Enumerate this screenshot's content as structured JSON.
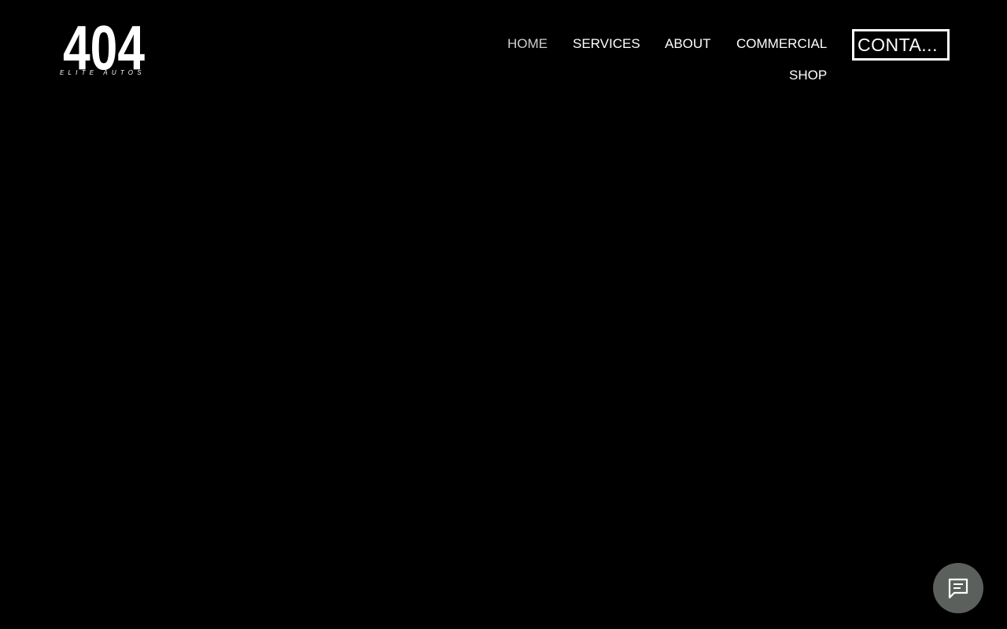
{
  "logo": {
    "mark_text": "404",
    "subtitle": "ELITE AUTOS",
    "icon": "brand-logo"
  },
  "nav": {
    "items": [
      {
        "label": "HOME",
        "active": true
      },
      {
        "label": "SERVICES",
        "active": false
      },
      {
        "label": "ABOUT",
        "active": false
      },
      {
        "label": "COMMERCIAL",
        "active": false
      },
      {
        "label": "SHOP",
        "active": false
      }
    ],
    "contact_label": "CONTA..."
  },
  "chat": {
    "icon": "chat-message-icon",
    "background_color": "#5c605d"
  },
  "colors": {
    "background": "#000000",
    "text": "#ffffff",
    "active_nav": "#cfcfcf"
  }
}
